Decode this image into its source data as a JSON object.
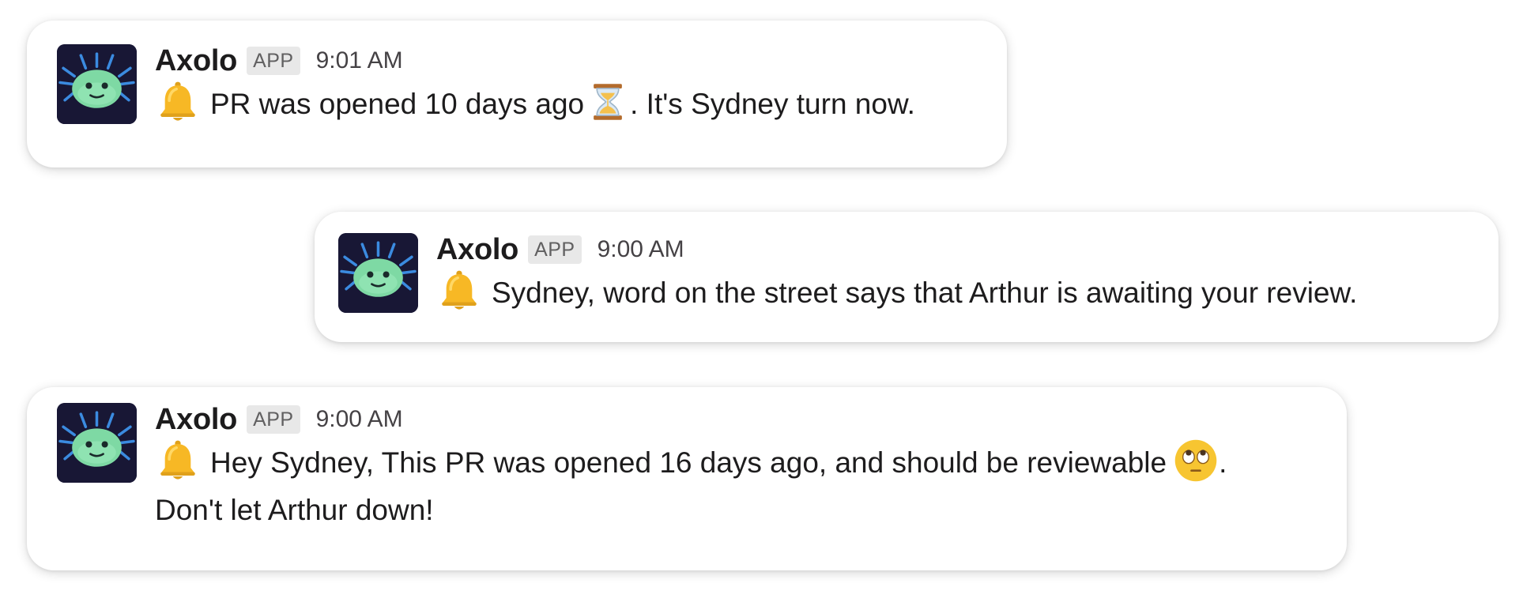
{
  "messages": [
    {
      "sender": "Axolo",
      "badge": "APP",
      "time": "9:01 AM",
      "icon": "bell-icon",
      "text_part1": "PR was opened 10 days ago",
      "inline_icon": "hourglass-icon",
      "text_part2": ". It's Sydney turn now."
    },
    {
      "sender": "Axolo",
      "badge": "APP",
      "time": "9:00 AM",
      "icon": "bell-icon",
      "text": "Sydney, word on the street says that Arthur is awaiting your review."
    },
    {
      "sender": "Axolo",
      "badge": "APP",
      "time": "9:00 AM",
      "icon": "bell-icon",
      "line1": "Hey Sydney, This PR was opened 16 days ago, and should be reviewable",
      "inline_icon": "face-with-rolling-eyes-icon",
      "line1_end": ".",
      "line2": "Don't let Arthur down!"
    }
  ],
  "colors": {
    "avatar_bg": "#181735",
    "axolotl_body": "#7ed9a4",
    "gills": "#3b8be0",
    "text": "#1d1c1d",
    "badge_bg": "#e8e8e8",
    "bell": "#f7b825"
  }
}
